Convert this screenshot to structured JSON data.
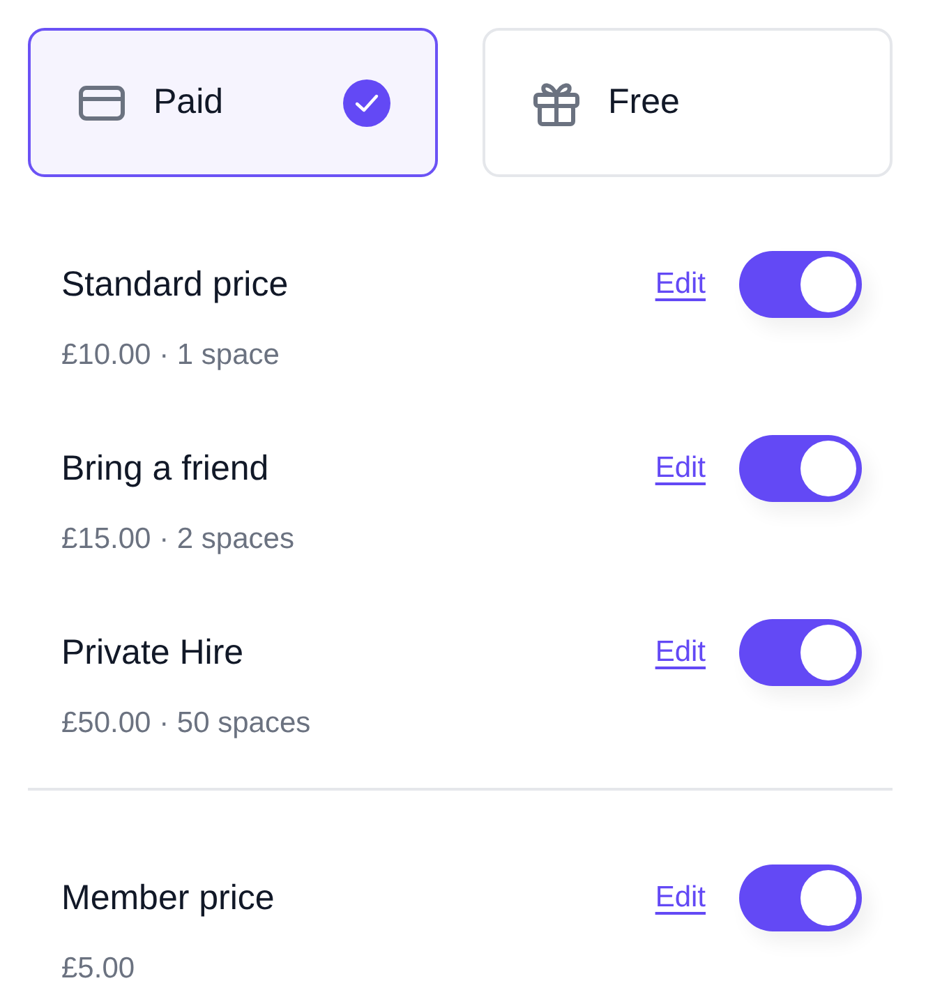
{
  "options": [
    {
      "label": "Paid",
      "kind": "card",
      "selected": true
    },
    {
      "label": "Free",
      "kind": "gift",
      "selected": false
    }
  ],
  "price_groups": [
    {
      "prices": [
        {
          "title": "Standard price",
          "detail": "£10.00 · 1 space",
          "edit": "Edit",
          "on": true
        },
        {
          "title": "Bring a friend",
          "detail": "£15.00 · 2 spaces",
          "edit": "Edit",
          "on": true
        },
        {
          "title": "Private Hire",
          "detail": "£50.00 · 50 spaces",
          "edit": "Edit",
          "on": true
        }
      ]
    },
    {
      "prices": [
        {
          "title": "Member price",
          "detail": "£5.00",
          "edit": "Edit",
          "on": true
        }
      ]
    }
  ]
}
